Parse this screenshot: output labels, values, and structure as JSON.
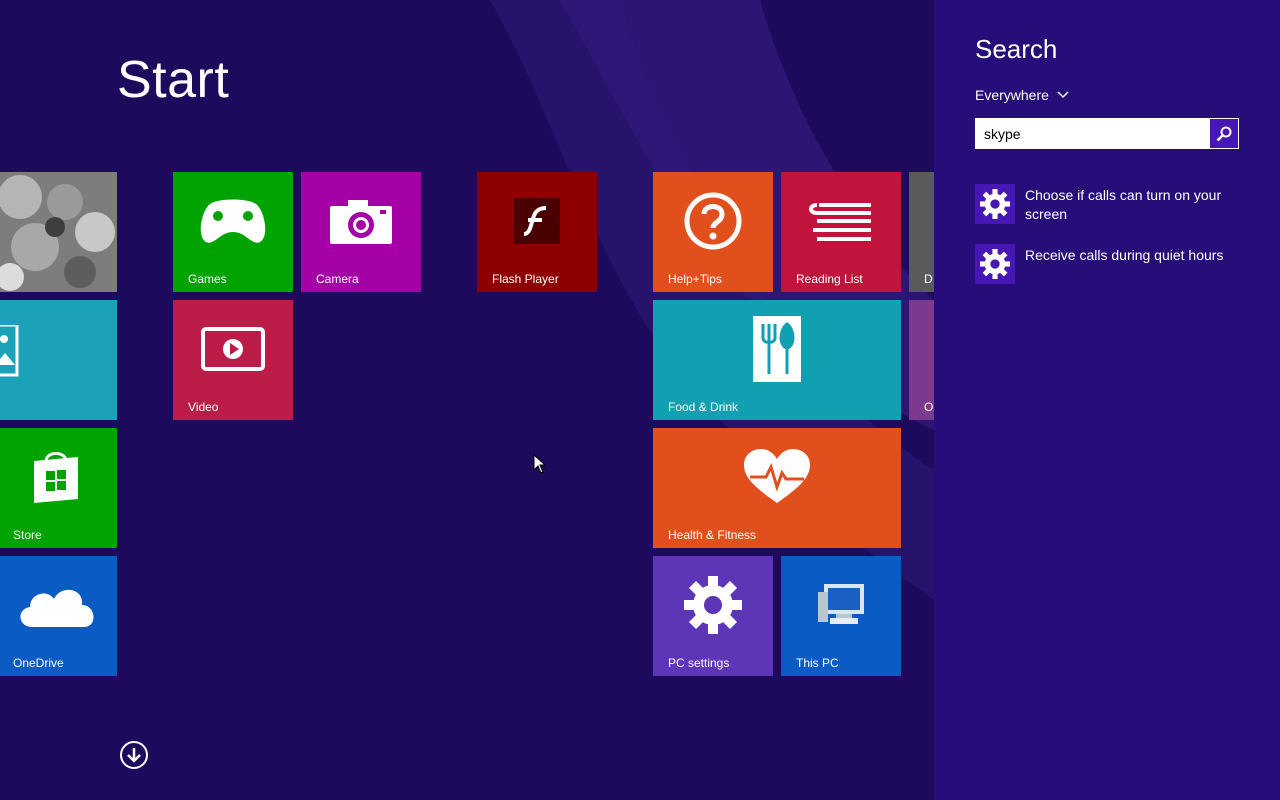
{
  "start": {
    "title": "Start",
    "colors": {
      "background": "#1d0a5c"
    },
    "tiles": [
      {
        "label": "",
        "icon": "photo-icon",
        "color": "#6a6a6a"
      },
      {
        "label": "",
        "icon": "weather-icon",
        "color": "#1ba1b8"
      },
      {
        "label": "Store",
        "icon": "store-bag-icon",
        "color": "#00a300"
      },
      {
        "label": "OneDrive",
        "icon": "cloud-icon",
        "color": "#0a5bc4"
      },
      {
        "label": "Games",
        "icon": "gamepad-icon",
        "color": "#00a300"
      },
      {
        "label": "Camera",
        "icon": "camera-icon",
        "color": "#a400a6"
      },
      {
        "label": "Video",
        "icon": "video-play-icon",
        "color": "#bc1c48"
      },
      {
        "label": "Flash Player",
        "icon": "flash-icon",
        "color": "#8e0000"
      },
      {
        "label": "Help+Tips",
        "icon": "question-icon",
        "color": "#e04f1c"
      },
      {
        "label": "Reading List",
        "icon": "reading-list-icon",
        "color": "#c1143c"
      },
      {
        "label": "Food & Drink",
        "icon": "fork-knife-icon",
        "color": "#11a0b2"
      },
      {
        "label": "Health & Fitness",
        "icon": "heart-pulse-icon",
        "color": "#e04f1c"
      },
      {
        "label": "PC settings",
        "icon": "gear-icon",
        "color": "#5d36b8"
      },
      {
        "label": "This PC",
        "icon": "computer-icon",
        "color": "#0a5bc4"
      },
      {
        "label": "D",
        "icon": "",
        "color": "#5a5a5a"
      },
      {
        "label": "O",
        "icon": "",
        "color": "#7b3a8e"
      }
    ]
  },
  "search": {
    "title": "Search",
    "scope": "Everywhere",
    "query": "skype",
    "colors": {
      "pane": "#260d7a",
      "accent": "#4617b4"
    },
    "results": [
      {
        "label": "Choose if calls can turn on your screen",
        "icon": "gear-icon"
      },
      {
        "label": "Receive calls during quiet hours",
        "icon": "gear-icon"
      }
    ]
  }
}
